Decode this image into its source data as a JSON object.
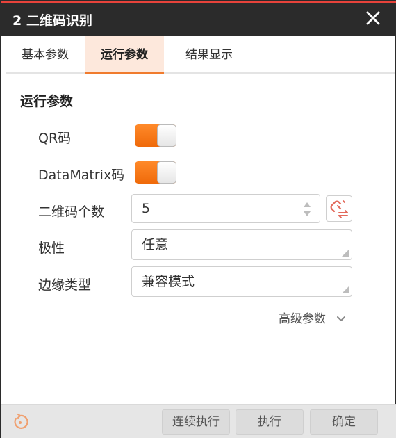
{
  "window": {
    "title": "2 二维码识别",
    "close_icon": "close-icon"
  },
  "tabs": [
    {
      "label": "基本参数",
      "active": false
    },
    {
      "label": "运行参数",
      "active": true
    },
    {
      "label": "结果显示",
      "active": false
    }
  ],
  "section": {
    "title": "运行参数"
  },
  "params": {
    "qr": {
      "label": "QR码",
      "enabled": true
    },
    "datamatrix": {
      "label": "DataMatrix码",
      "enabled": true
    },
    "code_count": {
      "label": "二维码个数",
      "value": "5"
    },
    "polarity": {
      "label": "极性",
      "value": "任意"
    },
    "edge_type": {
      "label": "边缘类型",
      "value": "兼容模式"
    }
  },
  "advanced": {
    "label": "高级参数"
  },
  "footer": {
    "continuous_label": "连续执行",
    "execute_label": "执行",
    "confirm_label": "确定"
  },
  "colors": {
    "accent": "#f07b2d",
    "titlebar": "#2b2b2b",
    "toggle_on": "#ff7a18"
  }
}
